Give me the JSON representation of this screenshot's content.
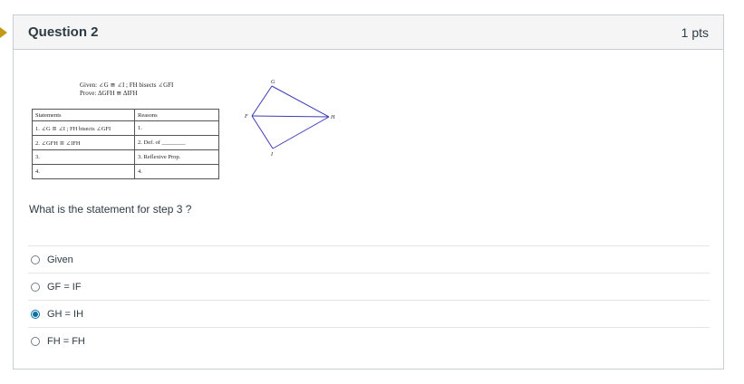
{
  "question": {
    "title": "Question 2",
    "points": "1 pts",
    "prompt": "What is the  statement for step 3 ?"
  },
  "figure": {
    "given": "Given:  ∠G ≅ ∠I ;  FH  bisects ∠GFI",
    "prove": "Prove:  ΔGFH ≅ ΔIFH",
    "table": {
      "headers": [
        "Statements",
        "Reasons"
      ],
      "rows": [
        [
          "1. ∠G ≅ ∠I ; FH bisects ∠GFI",
          "1."
        ],
        [
          "2. ∠GFH ≅ ∠IFH",
          "2. Def. of ________"
        ],
        [
          "3.",
          "3. Reflexive Prop."
        ],
        [
          "4.",
          "4."
        ]
      ]
    },
    "points": {
      "G": "G",
      "F": "F",
      "H": "H",
      "I": "I"
    },
    "line_color": "#3b3bb8"
  },
  "answers": [
    {
      "label": "Given",
      "selected": false
    },
    {
      "label": "GF = IF",
      "selected": false
    },
    {
      "label": "GH = IH",
      "selected": true
    },
    {
      "label": "FH = FH",
      "selected": false
    }
  ],
  "colors": {
    "accent": "#0770a3",
    "marker": "#c49a14",
    "text": "#2d3b45"
  }
}
